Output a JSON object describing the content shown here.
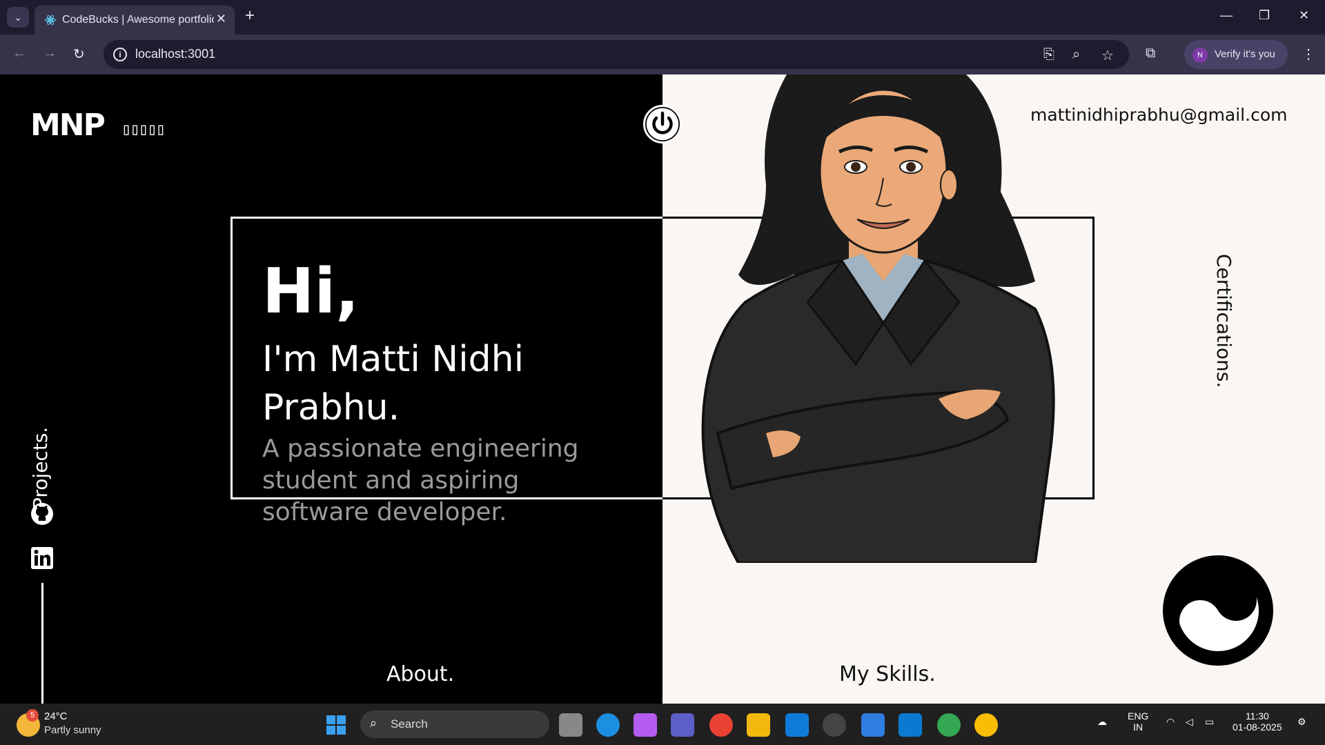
{
  "browser": {
    "tab_title": "CodeBucks | Awesome portfolio",
    "url": "localhost:3001",
    "verify_label": "Verify it's you",
    "profile_initial": "N"
  },
  "page": {
    "logo": "MNP",
    "email": "mattinidhiprabhu@gmail.com",
    "projects_label": "Projects.",
    "certifications_label": "Certifications.",
    "greeting": "Hi,",
    "name_line": "I'm Matti Nidhi Prabhu.",
    "tagline": "A passionate engineering student and aspiring software developer.",
    "about_label": "About.",
    "skills_label": "My Skills.",
    "hamburger_glyph": "▯▯▯▯▯"
  },
  "taskbar": {
    "weather_badge": "5",
    "temperature": "24°C",
    "condition": "Partly sunny",
    "search_label": "Search",
    "lang_top": "ENG",
    "lang_bottom": "IN",
    "time": "11:30",
    "date": "01-08-2025"
  },
  "colors": {
    "left_bg": "#000000",
    "right_bg": "#faf6f3",
    "tab_bar": "#1f1b2e"
  }
}
